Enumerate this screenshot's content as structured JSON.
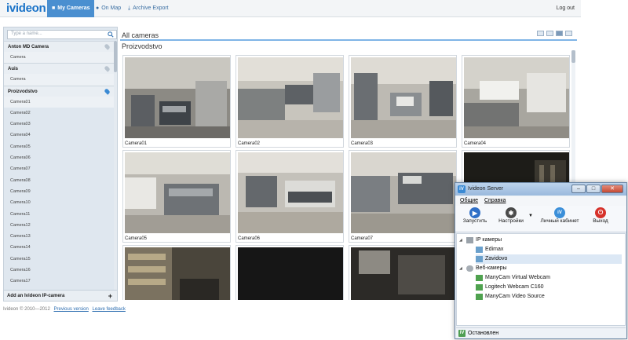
{
  "nav": {
    "logo": "ivideon",
    "tabs": [
      {
        "label": "My Cameras",
        "icon": "camera-icon"
      },
      {
        "label": "On Map",
        "icon": "map-pin-icon"
      },
      {
        "label": "Archive Export",
        "icon": "download-icon"
      }
    ],
    "logout": "Log out"
  },
  "sidebar": {
    "search_placeholder": "Type a name...",
    "groups": [
      {
        "name": "Anton MD Camera",
        "items": [
          "Camera"
        ]
      },
      {
        "name": "Auis",
        "items": [
          "Camera"
        ]
      },
      {
        "name": "Proizvodstvo",
        "items": [
          "Camera01",
          "Camera02",
          "Camera03",
          "Camera04",
          "Camera05",
          "Camera06",
          "Camera07",
          "Camera08",
          "Camera09",
          "Camera10",
          "Camera11",
          "Camera12",
          "Camera13",
          "Camera14",
          "Camera15",
          "Camera16",
          "Camera17"
        ]
      }
    ],
    "add_camera": "Add an Ivideon IP-camera"
  },
  "main": {
    "title": "All cameras",
    "group_heading": "Proizvodstvo",
    "cameras": [
      "Camera01",
      "Camera02",
      "Camera03",
      "Camera04",
      "Camera05",
      "Camera06",
      "Camera07",
      "",
      "",
      "",
      "",
      ""
    ]
  },
  "footer": {
    "copyright": "Ivideon © 2010—2012",
    "previous_version": "Previous version",
    "leave_feedback": "Leave feedback"
  },
  "server_window": {
    "title": "Ivideon Server",
    "menu": [
      "Общие",
      "Справка"
    ],
    "toolbar": [
      "Запустить",
      "Настройки",
      "Личный кабинет",
      "Выход"
    ],
    "tree": [
      {
        "label": "IP камеры",
        "level": 0
      },
      {
        "label": "Edimax",
        "level": 1
      },
      {
        "label": "Zavidovo",
        "level": 1
      },
      {
        "label": "Веб-камеры",
        "level": 0
      },
      {
        "label": "ManyCam Virtual Webcam",
        "level": 1
      },
      {
        "label": "Logitech Webcam C160",
        "level": 1
      },
      {
        "label": "ManyCam Video Source",
        "level": 1
      }
    ],
    "status": "Остановлен"
  }
}
